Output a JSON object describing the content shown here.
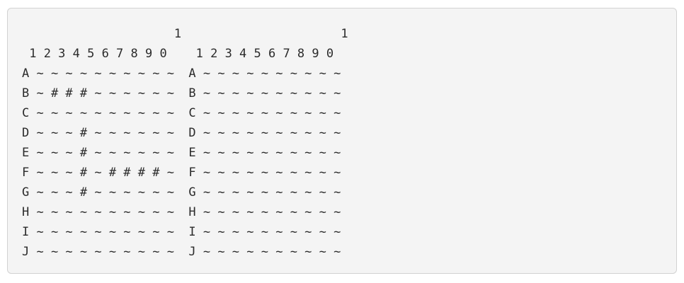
{
  "board_output": {
    "lines": [
      "                     1                      1",
      " 1 2 3 4 5 6 7 8 9 0    1 2 3 4 5 6 7 8 9 0",
      "A ~ ~ ~ ~ ~ ~ ~ ~ ~ ~  A ~ ~ ~ ~ ~ ~ ~ ~ ~ ~",
      "B ~ # # # ~ ~ ~ ~ ~ ~  B ~ ~ ~ ~ ~ ~ ~ ~ ~ ~",
      "C ~ ~ ~ ~ ~ ~ ~ ~ ~ ~  C ~ ~ ~ ~ ~ ~ ~ ~ ~ ~",
      "D ~ ~ ~ # ~ ~ ~ ~ ~ ~  D ~ ~ ~ ~ ~ ~ ~ ~ ~ ~",
      "E ~ ~ ~ # ~ ~ ~ ~ ~ ~  E ~ ~ ~ ~ ~ ~ ~ ~ ~ ~",
      "F ~ ~ ~ # ~ # # # # ~  F ~ ~ ~ ~ ~ ~ ~ ~ ~ ~",
      "G ~ ~ ~ # ~ ~ ~ ~ ~ ~  G ~ ~ ~ ~ ~ ~ ~ ~ ~ ~",
      "H ~ ~ ~ ~ ~ ~ ~ ~ ~ ~  H ~ ~ ~ ~ ~ ~ ~ ~ ~ ~",
      "I ~ ~ ~ ~ ~ ~ ~ ~ ~ ~  I ~ ~ ~ ~ ~ ~ ~ ~ ~ ~",
      "J ~ ~ ~ ~ ~ ~ ~ ~ ~ ~  J ~ ~ ~ ~ ~ ~ ~ ~ ~ ~"
    ]
  }
}
